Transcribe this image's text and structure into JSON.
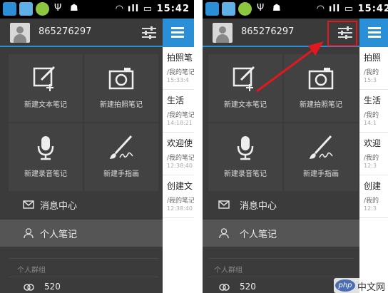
{
  "status_bar": {
    "time": "15:42",
    "signal_text": "ıll"
  },
  "user": {
    "id": "865276297"
  },
  "tiles": [
    {
      "label": "新建文本笔记",
      "icon": "edit-plus-icon"
    },
    {
      "label": "新建拍照笔记",
      "icon": "camera-icon"
    },
    {
      "label": "新建录音笔记",
      "icon": "microphone-icon"
    },
    {
      "label": "新建手指画",
      "icon": "brush-icon"
    }
  ],
  "nav": {
    "messages": "消息中心",
    "personal_notes": "个人笔记"
  },
  "groups_section": "个人群组",
  "group_item": "520",
  "notes_left": [
    {
      "title": "拍照笔",
      "path": "/我的笔记",
      "date": "15:33:4"
    },
    {
      "title": "生活",
      "path": "/我的笔记",
      "date": "14:18:21"
    },
    {
      "title": "欢迎使",
      "path": "/我的笔记",
      "date": "12:38:40"
    },
    {
      "title": "创建文",
      "path": "/我的笔记",
      "date": "12:38:40"
    }
  ],
  "notes_right": [
    {
      "title": "拍照",
      "path": "/我的",
      "date": "15:3"
    },
    {
      "title": "生活",
      "path": "/我的",
      "date": "14:1"
    },
    {
      "title": "欢迎",
      "path": "/我的",
      "date": "12:3"
    },
    {
      "title": "创建",
      "path": "/我的",
      "date": "12:3"
    }
  ],
  "watermark": {
    "logo": "php",
    "text": "中文网"
  },
  "colors": {
    "accent": "#2a8fd6",
    "highlight": "#e0191f",
    "drawer_bg": "#3b3b3b"
  }
}
